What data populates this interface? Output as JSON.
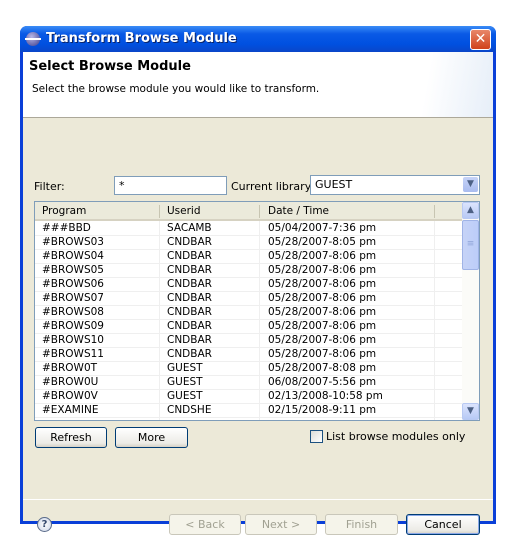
{
  "window": {
    "title": "Transform Browse Module"
  },
  "header": {
    "title": "Select Browse Module",
    "description": "Select the browse module you would like to transform."
  },
  "filter": {
    "label": "Filter:",
    "value": "*"
  },
  "library": {
    "label": "Current library:",
    "value": "GUEST"
  },
  "table": {
    "columns": [
      "Program",
      "Userid",
      "Date / Time"
    ],
    "rows": [
      [
        "###BBD",
        "SACAMB",
        "05/04/2007-7:36 pm"
      ],
      [
        "#BROWS03",
        "CNDBAR",
        "05/28/2007-8:05 pm"
      ],
      [
        "#BROWS04",
        "CNDBAR",
        "05/28/2007-8:06 pm"
      ],
      [
        "#BROWS05",
        "CNDBAR",
        "05/28/2007-8:06 pm"
      ],
      [
        "#BROWS06",
        "CNDBAR",
        "05/28/2007-8:06 pm"
      ],
      [
        "#BROWS07",
        "CNDBAR",
        "05/28/2007-8:06 pm"
      ],
      [
        "#BROWS08",
        "CNDBAR",
        "05/28/2007-8:06 pm"
      ],
      [
        "#BROWS09",
        "CNDBAR",
        "05/28/2007-8:06 pm"
      ],
      [
        "#BROWS10",
        "CNDBAR",
        "05/28/2007-8:06 pm"
      ],
      [
        "#BROWS11",
        "CNDBAR",
        "05/28/2007-8:06 pm"
      ],
      [
        "#BROW0T",
        "GUEST",
        "05/28/2007-8:08 pm"
      ],
      [
        "#BROW0U",
        "GUEST",
        "06/08/2007-5:56 pm"
      ],
      [
        "#BROW0V",
        "GUEST",
        "02/13/2008-10:58 pm"
      ],
      [
        "#EXAMINE",
        "CNDSHE",
        "02/15/2008-9:11 pm"
      ]
    ]
  },
  "buttons": {
    "refresh": "Refresh",
    "more": "More",
    "back": "< Back",
    "next": "Next >",
    "finish": "Finish",
    "cancel": "Cancel"
  },
  "checkbox": {
    "label": "List browse modules only",
    "checked": false
  },
  "icons": {
    "app": "eclipse-icon",
    "close": "close-icon",
    "help": "help-icon"
  }
}
